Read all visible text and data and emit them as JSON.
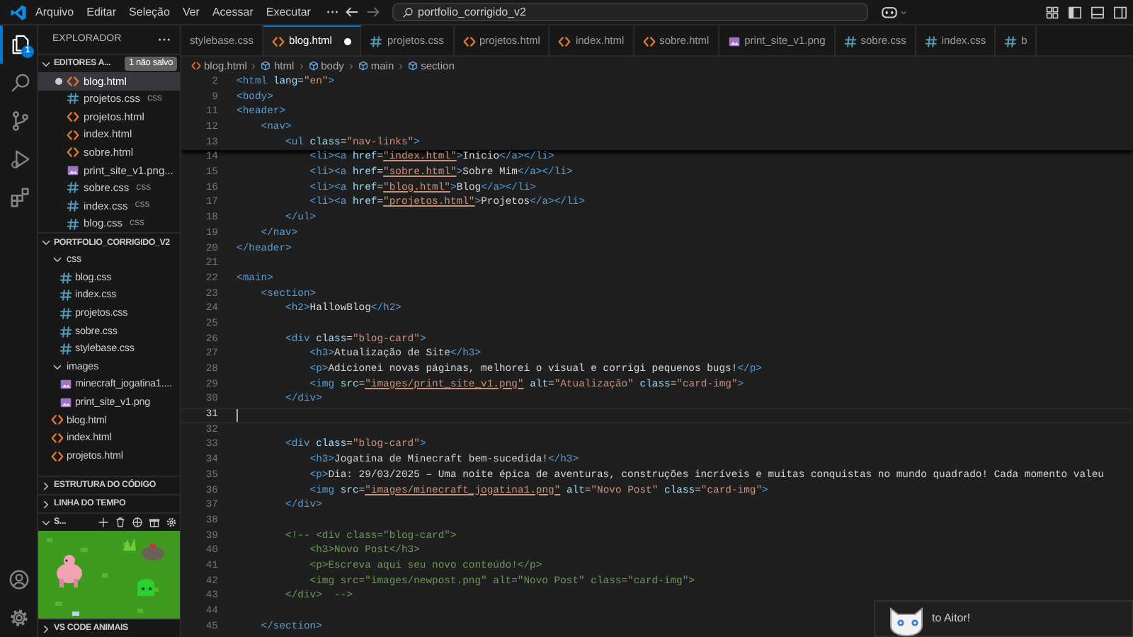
{
  "menu": [
    "Arquivo",
    "Editar",
    "Seleção",
    "Ver",
    "Acessar",
    "Executar"
  ],
  "command_center": {
    "text": "portfolio_corrigido_v2"
  },
  "activity_bar": {
    "items": [
      {
        "kind": "explorer",
        "selected": true,
        "badge": "1"
      },
      {
        "kind": "search",
        "selected": false
      },
      {
        "kind": "source-control",
        "selected": false
      },
      {
        "kind": "run",
        "selected": false
      },
      {
        "kind": "extensions",
        "selected": false
      }
    ],
    "bottom": [
      {
        "kind": "account"
      },
      {
        "kind": "settings"
      }
    ]
  },
  "sidebar": {
    "title": "EXPLORADOR",
    "open_editors": {
      "title": "EDITORES A...",
      "expanded": true,
      "badge": "1 não salvo",
      "items": [
        {
          "name": "blog.html",
          "kind": "html",
          "selected": true,
          "dirty": true
        },
        {
          "name": "projetos.css",
          "kind": "css",
          "description": "css",
          "selected": false,
          "dirty": false
        },
        {
          "name": "projetos.html",
          "kind": "html",
          "selected": false,
          "dirty": false
        },
        {
          "name": "index.html",
          "kind": "html",
          "selected": false,
          "dirty": false
        },
        {
          "name": "sobre.html",
          "kind": "html",
          "selected": false,
          "dirty": false
        },
        {
          "name": "print_site_v1.png...",
          "kind": "image",
          "selected": false,
          "dirty": false
        },
        {
          "name": "sobre.css",
          "kind": "css",
          "description": "css",
          "selected": false,
          "dirty": false
        },
        {
          "name": "index.css",
          "kind": "css",
          "description": "css",
          "selected": false,
          "dirty": false
        },
        {
          "name": "blog.css",
          "kind": "css",
          "description": "css",
          "selected": false,
          "dirty": false
        }
      ]
    },
    "folder": {
      "title": "PORTFOLIO_CORRIGIDO_V2",
      "expanded": true,
      "children": [
        {
          "name": "css",
          "kind": "folder",
          "expanded": true,
          "children": [
            {
              "name": "blog.css",
              "kind": "css"
            },
            {
              "name": "index.css",
              "kind": "css"
            },
            {
              "name": "projetos.css",
              "kind": "css"
            },
            {
              "name": "sobre.css",
              "kind": "css"
            },
            {
              "name": "stylebase.css",
              "kind": "css"
            }
          ]
        },
        {
          "name": "images",
          "kind": "folder",
          "expanded": true,
          "children": [
            {
              "name": "minecraft_jogatina1....",
              "kind": "image"
            },
            {
              "name": "print_site_v1.png",
              "kind": "image"
            }
          ]
        },
        {
          "name": "blog.html",
          "kind": "html"
        },
        {
          "name": "index.html",
          "kind": "html"
        },
        {
          "name": "projetos.html",
          "kind": "html"
        }
      ]
    },
    "sections": [
      {
        "title": "ESTRUTURA DO CÓDIGO",
        "expanded": false
      },
      {
        "title": "LINHA DO TEMPO",
        "expanded": false
      }
    ],
    "pets": {
      "title": "S...",
      "expanded": true
    },
    "bottom_section": {
      "title": "VS CODE ANIMAIS",
      "expanded": false
    }
  },
  "tabs": [
    {
      "name": "stylebase.css",
      "kind": "partial",
      "selected": false,
      "dirty": false
    },
    {
      "name": "blog.html",
      "kind": "html",
      "selected": true,
      "dirty": true
    },
    {
      "name": "projetos.css",
      "kind": "css",
      "selected": false,
      "dirty": false
    },
    {
      "name": "projetos.html",
      "kind": "html",
      "selected": false,
      "dirty": false
    },
    {
      "name": "index.html",
      "kind": "html",
      "selected": false,
      "dirty": false
    },
    {
      "name": "sobre.html",
      "kind": "html",
      "selected": false,
      "dirty": false
    },
    {
      "name": "print_site_v1.png",
      "kind": "image",
      "selected": false,
      "dirty": false
    },
    {
      "name": "sobre.css",
      "kind": "css",
      "selected": false,
      "dirty": false
    },
    {
      "name": "index.css",
      "kind": "css",
      "selected": false,
      "dirty": false
    },
    {
      "name": "b",
      "kind": "css",
      "selected": false,
      "dirty": false
    }
  ],
  "breadcrumb": [
    {
      "text": "blog.html",
      "kind": "html"
    },
    {
      "text": "html",
      "kind": "element"
    },
    {
      "text": "body",
      "kind": "element"
    },
    {
      "text": "main",
      "kind": "element"
    },
    {
      "text": "section",
      "kind": "element"
    }
  ],
  "editor": {
    "sticky_lines": [
      {
        "number": "2",
        "tokens": [
          {
            "kind": "tag",
            "text": "<html"
          },
          {
            "kind": "attr",
            "text": " lang"
          },
          {
            "kind": "text",
            "text": "="
          },
          {
            "kind": "str",
            "text": "\"en\""
          },
          {
            "kind": "tag",
            "text": ">"
          }
        ]
      },
      {
        "number": "9",
        "tokens": [
          {
            "kind": "tag",
            "text": "<body>"
          }
        ]
      },
      {
        "number": "11",
        "tokens": [
          {
            "kind": "tag",
            "text": "<header>"
          }
        ]
      },
      {
        "number": "12",
        "tokens": [
          {
            "kind": "tag",
            "text": "    <nav>"
          }
        ]
      },
      {
        "number": "13",
        "tokens": [
          {
            "kind": "tag",
            "text": "        <ul"
          },
          {
            "kind": "attr",
            "text": " class"
          },
          {
            "kind": "text",
            "text": "="
          },
          {
            "kind": "str",
            "text": "\"nav-links\""
          },
          {
            "kind": "tag",
            "text": ">"
          }
        ]
      }
    ],
    "lines": [
      {
        "number": "14",
        "current": false,
        "tokens": [
          {
            "kind": "tag",
            "text": "            <li><a"
          },
          {
            "kind": "attr",
            "text": " href"
          },
          {
            "kind": "text",
            "text": "="
          },
          {
            "kind": "link",
            "text": "\"index.html\""
          },
          {
            "kind": "tag",
            "text": ">"
          },
          {
            "kind": "text",
            "text": "Início"
          },
          {
            "kind": "tag",
            "text": "</a></li>"
          }
        ]
      },
      {
        "number": "15",
        "current": false,
        "tokens": [
          {
            "kind": "tag",
            "text": "            <li><a"
          },
          {
            "kind": "attr",
            "text": " href"
          },
          {
            "kind": "text",
            "text": "="
          },
          {
            "kind": "link",
            "text": "\"sobre.html\""
          },
          {
            "kind": "tag",
            "text": ">"
          },
          {
            "kind": "text",
            "text": "Sobre Mim"
          },
          {
            "kind": "tag",
            "text": "</a></li>"
          }
        ]
      },
      {
        "number": "16",
        "current": false,
        "tokens": [
          {
            "kind": "tag",
            "text": "            <li><a"
          },
          {
            "kind": "attr",
            "text": " href"
          },
          {
            "kind": "text",
            "text": "="
          },
          {
            "kind": "link",
            "text": "\"blog.html\""
          },
          {
            "kind": "tag",
            "text": ">"
          },
          {
            "kind": "text",
            "text": "Blog"
          },
          {
            "kind": "tag",
            "text": "</a></li>"
          }
        ]
      },
      {
        "number": "17",
        "current": false,
        "tokens": [
          {
            "kind": "tag",
            "text": "            <li><a"
          },
          {
            "kind": "attr",
            "text": " href"
          },
          {
            "kind": "text",
            "text": "="
          },
          {
            "kind": "link",
            "text": "\"projetos.html\""
          },
          {
            "kind": "tag",
            "text": ">"
          },
          {
            "kind": "text",
            "text": "Projetos"
          },
          {
            "kind": "tag",
            "text": "</a></li>"
          }
        ]
      },
      {
        "number": "18",
        "current": false,
        "tokens": [
          {
            "kind": "tag",
            "text": "        </ul>"
          }
        ]
      },
      {
        "number": "19",
        "current": false,
        "tokens": [
          {
            "kind": "tag",
            "text": "    </nav>"
          }
        ]
      },
      {
        "number": "20",
        "current": false,
        "tokens": [
          {
            "kind": "tag",
            "text": "</header>"
          }
        ]
      },
      {
        "number": "21",
        "current": false
      },
      {
        "number": "22",
        "current": false,
        "tokens": [
          {
            "kind": "tag",
            "text": "<main>"
          }
        ]
      },
      {
        "number": "23",
        "current": false,
        "tokens": [
          {
            "kind": "tag",
            "text": "    <section>"
          }
        ]
      },
      {
        "number": "24",
        "current": false,
        "tokens": [
          {
            "kind": "tag",
            "text": "        <h2>"
          },
          {
            "kind": "text",
            "text": "HallowBlog"
          },
          {
            "kind": "tag",
            "text": "</h2>"
          }
        ]
      },
      {
        "number": "25",
        "current": false
      },
      {
        "number": "26",
        "current": false,
        "tokens": [
          {
            "kind": "tag",
            "text": "        <div"
          },
          {
            "kind": "attr",
            "text": " class"
          },
          {
            "kind": "text",
            "text": "="
          },
          {
            "kind": "str",
            "text": "\"blog-card\""
          },
          {
            "kind": "tag",
            "text": ">"
          }
        ]
      },
      {
        "number": "27",
        "current": false,
        "tokens": [
          {
            "kind": "tag",
            "text": "            <h3>"
          },
          {
            "kind": "text",
            "text": "Atualização de Site"
          },
          {
            "kind": "tag",
            "text": "</h3>"
          }
        ]
      },
      {
        "number": "28",
        "current": false,
        "tokens": [
          {
            "kind": "tag",
            "text": "            <p>"
          },
          {
            "kind": "text",
            "text": "Adicionei novas páginas, melhorei o visual e corrigi pequenos bugs!"
          },
          {
            "kind": "tag",
            "text": "</p>"
          }
        ]
      },
      {
        "number": "29",
        "current": false,
        "tokens": [
          {
            "kind": "tag",
            "text": "            <img"
          },
          {
            "kind": "attr",
            "text": " src"
          },
          {
            "kind": "text",
            "text": "="
          },
          {
            "kind": "link",
            "text": "\"images/print_site_v1.png\""
          },
          {
            "kind": "attr",
            "text": " alt"
          },
          {
            "kind": "text",
            "text": "="
          },
          {
            "kind": "str",
            "text": "\"Atualização\""
          },
          {
            "kind": "attr",
            "text": " class"
          },
          {
            "kind": "text",
            "text": "="
          },
          {
            "kind": "str",
            "text": "\"card-img\""
          },
          {
            "kind": "tag",
            "text": ">"
          }
        ]
      },
      {
        "number": "30",
        "current": false,
        "tokens": [
          {
            "kind": "tag",
            "text": "        </div>"
          }
        ]
      },
      {
        "number": "31",
        "current": true
      },
      {
        "number": "32",
        "current": false
      },
      {
        "number": "33",
        "current": false,
        "tokens": [
          {
            "kind": "tag",
            "text": "        <div"
          },
          {
            "kind": "attr",
            "text": " class"
          },
          {
            "kind": "text",
            "text": "="
          },
          {
            "kind": "str",
            "text": "\"blog-card\""
          },
          {
            "kind": "tag",
            "text": ">"
          }
        ]
      },
      {
        "number": "34",
        "current": false,
        "tokens": [
          {
            "kind": "tag",
            "text": "            <h3>"
          },
          {
            "kind": "text",
            "text": "Jogatina de Minecraft bem-sucedida!"
          },
          {
            "kind": "tag",
            "text": "</h3>"
          }
        ]
      },
      {
        "number": "35",
        "current": false,
        "tokens": [
          {
            "kind": "tag",
            "text": "            <p>"
          },
          {
            "kind": "text",
            "text": "Dia: 29/03/2025 – Uma noite épica de aventuras, construções incríveis e muitas conquistas no mundo quadrado! Cada momento valeu"
          }
        ]
      },
      {
        "number": "36",
        "current": false,
        "tokens": [
          {
            "kind": "tag",
            "text": "            <img"
          },
          {
            "kind": "attr",
            "text": " src"
          },
          {
            "kind": "text",
            "text": "="
          },
          {
            "kind": "link",
            "text": "\"images/minecraft_jogatina1.png\""
          },
          {
            "kind": "attr",
            "text": " alt"
          },
          {
            "kind": "text",
            "text": "="
          },
          {
            "kind": "str",
            "text": "\"Novo Post\""
          },
          {
            "kind": "attr",
            "text": " class"
          },
          {
            "kind": "text",
            "text": "="
          },
          {
            "kind": "str",
            "text": "\"card-img\""
          },
          {
            "kind": "tag",
            "text": ">"
          }
        ]
      },
      {
        "number": "37",
        "current": false,
        "tokens": [
          {
            "kind": "tag",
            "text": "        </div>"
          }
        ]
      },
      {
        "number": "38",
        "current": false
      },
      {
        "number": "39",
        "current": false,
        "tokens": [
          {
            "kind": "comment",
            "text": "        <!-- <div class=\"blog-card\">"
          }
        ]
      },
      {
        "number": "40",
        "current": false,
        "tokens": [
          {
            "kind": "comment",
            "text": "            <h3>Novo Post</h3>"
          }
        ]
      },
      {
        "number": "41",
        "current": false,
        "tokens": [
          {
            "kind": "comment",
            "text": "            <p>Escreva aqui seu novo conteúdo!</p>"
          }
        ]
      },
      {
        "number": "42",
        "current": false,
        "tokens": [
          {
            "kind": "comment",
            "text": "            <img src=\"images/newpost.png\" alt=\"Novo Post\" class=\"card-img\">"
          }
        ]
      },
      {
        "number": "43",
        "current": false,
        "tokens": [
          {
            "kind": "comment",
            "text": "        </div>  -->"
          }
        ]
      },
      {
        "number": "44",
        "current": false
      },
      {
        "number": "45",
        "current": false,
        "tokens": [
          {
            "kind": "tag",
            "text": "    </section>"
          }
        ]
      }
    ]
  },
  "notification": {
    "text": "to Aitor!"
  }
}
